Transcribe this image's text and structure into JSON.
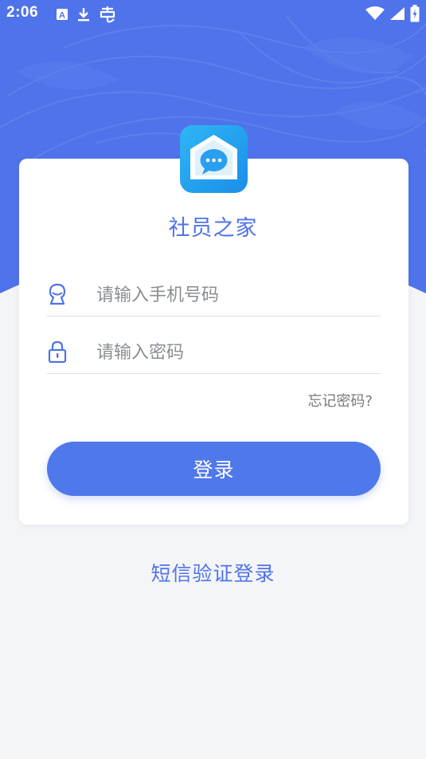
{
  "status_bar": {
    "time": "2:06",
    "left_icons": [
      "keyboard-a-icon",
      "download-icon",
      "bug-icon"
    ],
    "right_icons": [
      "wifi-icon",
      "cell-signal-icon",
      "battery-charging-icon"
    ]
  },
  "app": {
    "title": "社员之家",
    "logo_icon": "chat-house-icon"
  },
  "form": {
    "phone": {
      "placeholder": "请输入手机号码",
      "value": "",
      "icon": "user-icon"
    },
    "password": {
      "placeholder": "请输入密码",
      "value": "",
      "icon": "lock-icon"
    },
    "forgot_password": "忘记密码?",
    "login_label": "登录"
  },
  "sms_login_label": "短信验证登录",
  "colors": {
    "primary": "#4f78ea",
    "header_bg": "#4f73ea",
    "page_bg": "#f4f5f7",
    "card_bg": "#ffffff",
    "placeholder": "#8a8d93",
    "logo_light": "#2fb6f5",
    "logo_dark": "#1a8ee9"
  }
}
